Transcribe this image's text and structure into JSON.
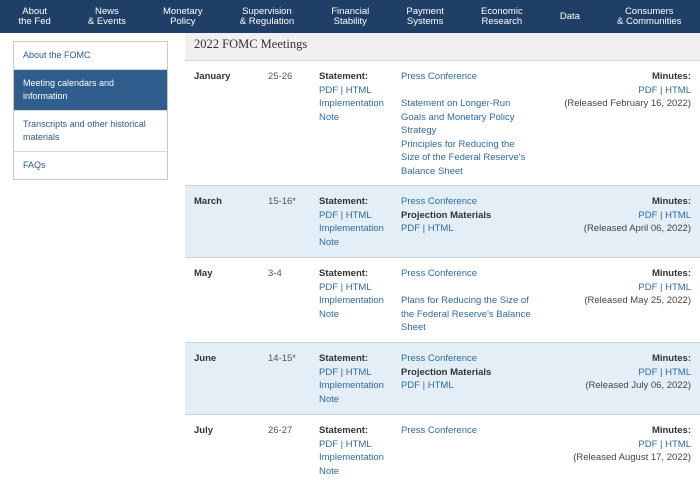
{
  "nav": {
    "items": [
      {
        "l1": "About",
        "l2": "the Fed"
      },
      {
        "l1": "News",
        "l2": "& Events"
      },
      {
        "l1": "Monetary",
        "l2": "Policy"
      },
      {
        "l1": "Supervision",
        "l2": "& Regulation"
      },
      {
        "l1": "Financial",
        "l2": "Stability"
      },
      {
        "l1": "Payment",
        "l2": "Systems"
      },
      {
        "l1": "Economic",
        "l2": "Research"
      },
      {
        "l1": "Data",
        "l2": ""
      },
      {
        "l1": "Consumers",
        "l2": "& Communities"
      }
    ]
  },
  "sidebar": {
    "items": [
      {
        "label": "About the FOMC"
      },
      {
        "label": "Meeting calendars and information"
      },
      {
        "label": "Transcripts and other historical materials"
      },
      {
        "label": "FAQs"
      }
    ]
  },
  "main": {
    "title": "2022 FOMC Meetings",
    "labels": {
      "statement": "Statement:",
      "pdf": "PDF",
      "sep": "|",
      "html": "HTML",
      "implementation_note": "Implementation Note",
      "press_conference": "Press Conference",
      "projection_materials": "Projection Materials",
      "minutes": "Minutes:"
    },
    "meetings": [
      {
        "month": "January",
        "dates": "25-26",
        "extra_links": [
          "Statement on Longer-Run Goals and Monetary Policy Strategy",
          "Principles for Reducing the Size of the Federal Reserve's Balance Sheet"
        ],
        "released": "(Released February 16, 2022)"
      },
      {
        "month": "March",
        "dates": "15-16*",
        "released": "(Released April 06, 2022)"
      },
      {
        "month": "May",
        "dates": "3-4",
        "extra_links": [
          "Plans for Reducing the Size of the Federal Reserve's Balance Sheet"
        ],
        "released": "(Released May 25, 2022)"
      },
      {
        "month": "June",
        "dates": "14-15*",
        "released": "(Released July 06, 2022)"
      },
      {
        "month": "July",
        "dates": "26-27",
        "released": "(Released August 17, 2022)"
      }
    ]
  }
}
